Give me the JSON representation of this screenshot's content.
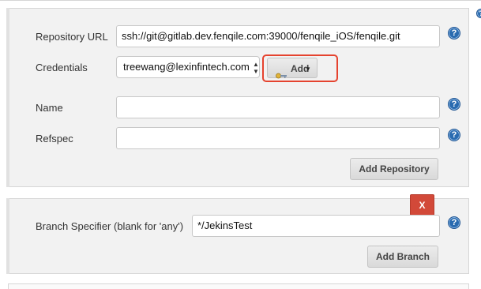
{
  "repository": {
    "url_label": "Repository URL",
    "url_value": "ssh://git@gitlab.dev.fenqile.com:39000/fenqile_iOS/fenqile.git",
    "credentials_label": "Credentials",
    "credentials_value": "treewang@lexinfintech.com",
    "add_label": "Add",
    "name_label": "Name",
    "name_value": "",
    "refspec_label": "Refspec",
    "refspec_value": "",
    "add_repository_label": "Add Repository"
  },
  "branch": {
    "delete_label": "X",
    "specifier_label": "Branch Specifier (blank for 'any')",
    "specifier_value": "*/JekinsTest",
    "add_branch_label": "Add Branch"
  },
  "help_glyph": "?",
  "colors": {
    "section_bg": "#f2f2f2",
    "help_blue": "#2a6bb0",
    "delete_red": "#d24939",
    "highlight_red": "#e5432f"
  },
  "icons": [
    "key-icon",
    "dropdown-arrow-icon",
    "help-icon",
    "select-arrows-icon"
  ]
}
